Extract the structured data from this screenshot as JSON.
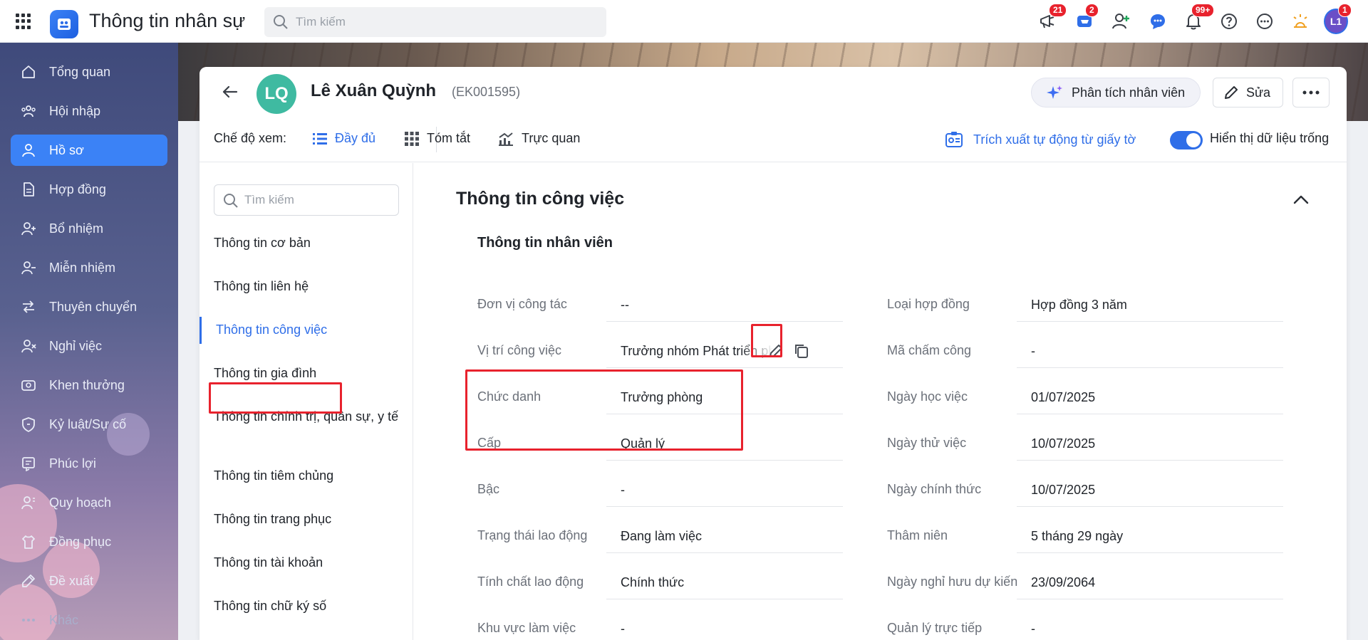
{
  "app": {
    "title": "Thông tin nhân sự",
    "search_placeholder": "Tìm kiếm",
    "notifications": {
      "announcements": "21",
      "cart": "2",
      "alerts": "99+",
      "profile": "1"
    },
    "user_initials": "L1"
  },
  "sidebar": {
    "items": [
      {
        "label": "Tổng quan",
        "icon": "home-icon"
      },
      {
        "label": "Hội nhập",
        "icon": "people-icon"
      },
      {
        "label": "Hồ sơ",
        "icon": "user-icon"
      },
      {
        "label": "Hợp đồng",
        "icon": "document-icon"
      },
      {
        "label": "Bổ nhiệm",
        "icon": "user-plus-icon"
      },
      {
        "label": "Miễn nhiệm",
        "icon": "user-minus-icon"
      },
      {
        "label": "Thuyên chuyển",
        "icon": "transfer-icon"
      },
      {
        "label": "Nghỉ việc",
        "icon": "user-x-icon"
      },
      {
        "label": "Khen thưởng",
        "icon": "award-icon"
      },
      {
        "label": "Kỷ luật/Sự cố",
        "icon": "shield-icon"
      },
      {
        "label": "Phúc lợi",
        "icon": "benefit-icon"
      },
      {
        "label": "Quy hoạch",
        "icon": "plan-icon"
      },
      {
        "label": "Đồng phục",
        "icon": "shirt-icon"
      },
      {
        "label": "Đề xuất",
        "icon": "proposal-icon"
      },
      {
        "label": "Khác",
        "icon": "dots-icon"
      }
    ],
    "active_index": 2
  },
  "employee": {
    "initials": "LQ",
    "name": "Lê Xuân Quỳnh",
    "code": "(EK001595)",
    "analyze_label": "Phân tích nhân viên",
    "edit_label": "Sửa"
  },
  "viewbar": {
    "label": "Chế độ xem:",
    "options": [
      "Đầy đủ",
      "Tóm tắt",
      "Trực quan"
    ],
    "active_option": "Đầy đủ",
    "extract_label": "Trích xuất tự động từ giấy tờ",
    "toggle_label": "Hiển thị dữ liệu trống",
    "toggle_on": true
  },
  "section_nav": {
    "search_placeholder": "Tìm kiếm",
    "items": [
      "Thông tin cơ bản",
      "Thông tin liên hệ",
      "Thông tin công việc",
      "Thông tin gia đình",
      "Thông tin chính trị, quân sự, y tế",
      "Thông tin tiêm chủng",
      "Thông tin trang phục",
      "Thông tin tài khoản",
      "Thông tin chữ ký số"
    ],
    "active_item": "Thông tin công việc"
  },
  "details": {
    "section_title": "Thông tin công việc",
    "subsection_title": "Thông tin nhân viên",
    "left_fields": [
      {
        "label": "Đơn vị công tác",
        "value": "--"
      },
      {
        "label": "Vị trí công việc",
        "value": "Trưởng nhóm Phát triển phần mềm"
      },
      {
        "label": "Chức danh",
        "value": "Trưởng phòng"
      },
      {
        "label": "Cấp",
        "value": "Quản lý"
      },
      {
        "label": "Bậc",
        "value": "-"
      },
      {
        "label": "Trạng thái lao động",
        "value": "Đang làm việc"
      },
      {
        "label": "Tính chất lao động",
        "value": "Chính thức"
      },
      {
        "label": "Khu vực làm việc",
        "value": "-"
      }
    ],
    "right_fields": [
      {
        "label": "Loại hợp đồng",
        "value": "Hợp đồng 3 năm"
      },
      {
        "label": "Mã chấm công",
        "value": "-"
      },
      {
        "label": "Ngày học việc",
        "value": "01/07/2025"
      },
      {
        "label": "Ngày thử việc",
        "value": "10/07/2025"
      },
      {
        "label": "Ngày chính thức",
        "value": "10/07/2025"
      },
      {
        "label": "Thâm niên",
        "value": "5 tháng 29 ngày"
      },
      {
        "label": "Ngày nghỉ hưu dự kiến",
        "value": "23/09/2064"
      },
      {
        "label": "Quản lý trực tiếp",
        "value": "-"
      }
    ]
  },
  "colors": {
    "accent": "#2f6ee8",
    "sidebar_active": "#3b82f6",
    "highlight": "#e8222d",
    "avatar": "#3fbaa1"
  }
}
